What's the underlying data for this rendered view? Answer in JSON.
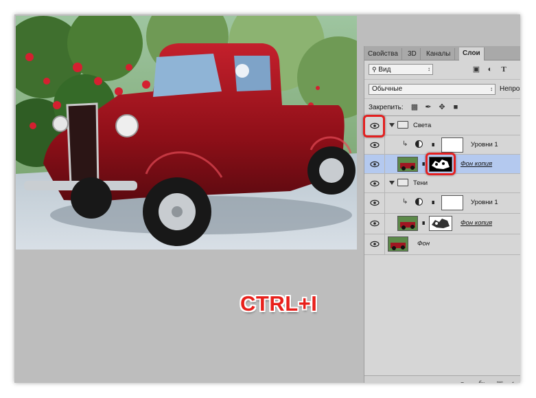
{
  "panel": {
    "tabs": [
      {
        "label": "Свойства",
        "active": false
      },
      {
        "label": "3D",
        "active": false
      },
      {
        "label": "Каналы",
        "active": false
      },
      {
        "label": "Слои",
        "active": true
      }
    ],
    "filter_kind": "Вид",
    "blend_mode": "Обычные",
    "opacity_label": "Непроз",
    "lock_label": "Закрепить:",
    "layers": [
      {
        "type": "group",
        "name": "Света",
        "visible": true,
        "expanded": true
      },
      {
        "type": "adjustment",
        "name": "Уровни 1",
        "visible": true,
        "clipped": true
      },
      {
        "type": "pixel-mask",
        "name": "Фон копия",
        "visible": true,
        "selected": true
      },
      {
        "type": "group",
        "name": "Тени",
        "visible": true,
        "expanded": true
      },
      {
        "type": "adjustment",
        "name": "Уровни 1",
        "visible": true,
        "clipped": true
      },
      {
        "type": "pixel-mask",
        "name": "Фон копия",
        "visible": true,
        "selected": false
      },
      {
        "type": "background",
        "name": "Фон",
        "visible": true
      }
    ],
    "bottom_icons": [
      "link-icon",
      "fx-icon",
      "mask-icon"
    ]
  },
  "overlay": {
    "hotkey": "CTRL+I"
  },
  "colors": {
    "accent_red": "#e32020",
    "selected_row": "#b4c9ef",
    "canvas_bg": "#bdbdbd"
  }
}
